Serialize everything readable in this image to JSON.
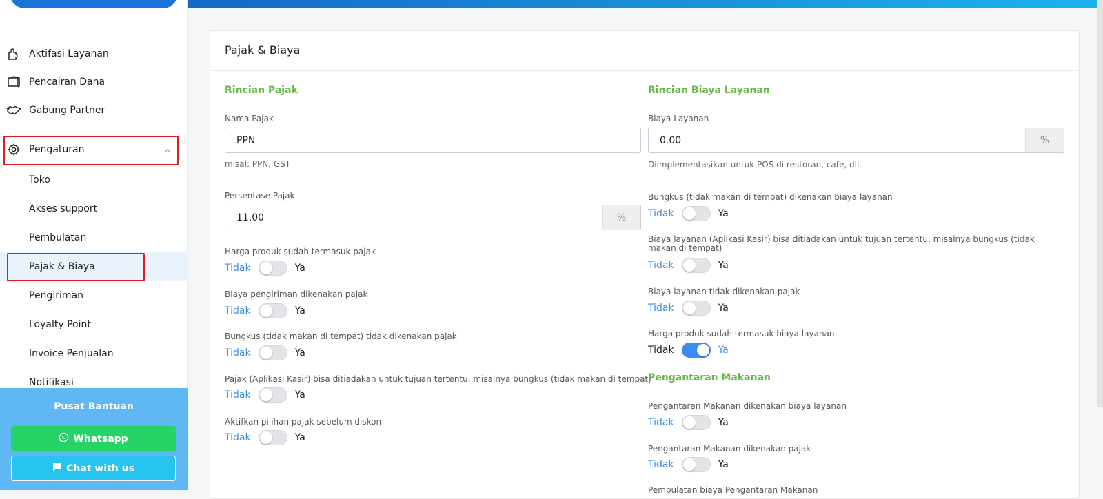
{
  "sidebar": {
    "items": [
      {
        "label": "Aktifasi Layanan",
        "icon": "puzzle-icon"
      },
      {
        "label": "Pencairan Dana",
        "icon": "wallet-icon"
      },
      {
        "label": "Gabung Partner",
        "icon": "handshake-icon"
      },
      {
        "label": "Pengaturan",
        "icon": "gear-icon"
      }
    ],
    "sub_items": [
      "Toko",
      "Akses support",
      "Pembulatan",
      "Pajak & Biaya",
      "Pengiriman",
      "Loyalty Point",
      "Invoice Penjualan",
      "Notifikasi"
    ],
    "active_sub_item": "Pajak & Biaya"
  },
  "help": {
    "title": "Pusat Bantuan",
    "whatsapp_label": "Whatsapp",
    "chat_label": "Chat with us"
  },
  "card": {
    "title": "Pajak & Biaya"
  },
  "tax": {
    "section_title": "Rincian Pajak",
    "name_label": "Nama Pajak",
    "name_value": "PPN",
    "name_hint": "misal: PPN, GST",
    "percent_label": "Persentase Pajak",
    "percent_value": "11.00",
    "percent_suffix": "%",
    "toggles": [
      {
        "label": "Harga produk sudah termasuk pajak",
        "on": false
      },
      {
        "label": "Biaya pengiriman dikenakan pajak",
        "on": false
      },
      {
        "label": "Bungkus (tidak makan di tempat) tidak dikenakan pajak",
        "on": false
      },
      {
        "label": "Pajak (Aplikasi Kasir) bisa ditiadakan untuk tujuan tertentu, misalnya bungkus (tidak makan di tempat)",
        "on": false
      },
      {
        "label": "Aktifkan pilihan pajak sebelum diskon",
        "on": false
      }
    ]
  },
  "service": {
    "section_title": "Rincian Biaya Layanan",
    "fee_label": "Biaya Layanan",
    "fee_value": "0.00",
    "fee_suffix": "%",
    "fee_hint": "Diimplementasikan untuk POS di restoran, cafe, dll.",
    "toggles": [
      {
        "label": "Bungkus (tidak makan di tempat) dikenakan biaya layanan",
        "on": false
      },
      {
        "label": "Biaya layanan (Aplikasi Kasir) bisa ditiadakan untuk tujuan tertentu, misalnya bungkus (tidak makan di tempat)",
        "on": false
      },
      {
        "label": "Biaya layanan tidak dikenakan pajak",
        "on": false
      },
      {
        "label": "Harga produk sudah termasuk biaya layanan",
        "on": true
      }
    ]
  },
  "delivery": {
    "section_title": "Pengantaran Makanan",
    "toggles": [
      {
        "label": "Pengantaran Makanan dikenakan biaya layanan",
        "on": false
      },
      {
        "label": "Pengantaran Makanan dikenakan pajak",
        "on": false
      }
    ],
    "partial_label": "Pembulatan biaya Pengantaran Makanan"
  },
  "toggle_text": {
    "off": "Tidak",
    "on": "Ya"
  },
  "colors": {
    "accent": "#3a8cf0",
    "section_green": "#67b948",
    "whatsapp": "#25d366",
    "chat": "#27c4f0",
    "highlight_border": "#e01b24"
  }
}
